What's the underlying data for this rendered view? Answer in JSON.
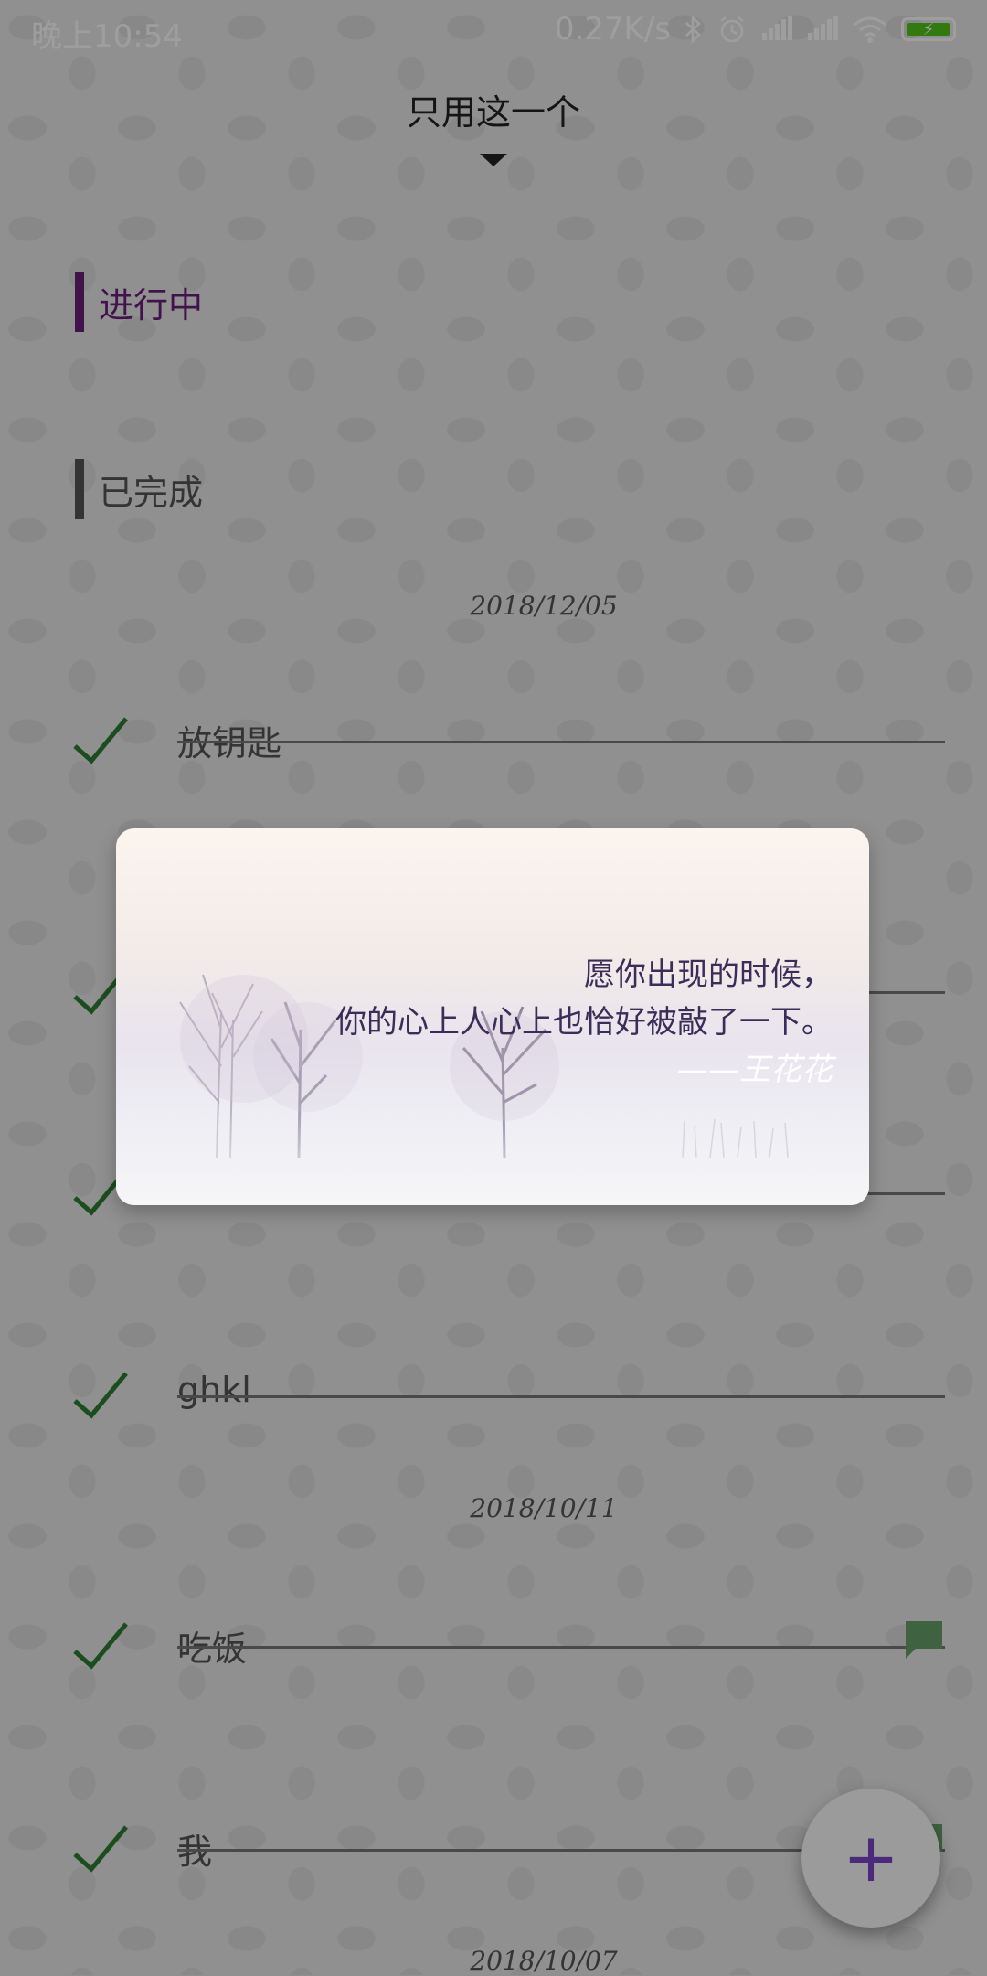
{
  "status_bar": {
    "time": "晚上10:54",
    "network_speed": "0.27K/s",
    "icons": [
      "bluetooth-icon",
      "alarm-icon",
      "signal-icon",
      "signal-icon",
      "wifi-icon",
      "battery-charging-icon"
    ]
  },
  "header": {
    "title": "只用这一个"
  },
  "sections": {
    "in_progress": "进行中",
    "completed": "已完成"
  },
  "groups": [
    {
      "date": "2018/12/05"
    },
    {
      "date": "2018/10/11"
    },
    {
      "date": "2018/10/07"
    }
  ],
  "tasks": [
    {
      "label": "放钥匙",
      "done": true
    },
    {
      "label": "",
      "done": true
    },
    {
      "label": "",
      "done": true
    },
    {
      "label": "ghkl",
      "done": true
    },
    {
      "label": "吃饭",
      "done": true,
      "has_comment": true
    },
    {
      "label": "我",
      "done": true,
      "has_comment": true
    }
  ],
  "dialog": {
    "line1": "愿你出现的时候，",
    "line2": "你的心上人心上也恰好被敲了一下。",
    "author": "——王花花"
  },
  "fab": {
    "label": "+"
  },
  "colors": {
    "accent": "#6a1f7a",
    "check": "#2e7d32",
    "fab_icon": "#4b2a7b"
  }
}
